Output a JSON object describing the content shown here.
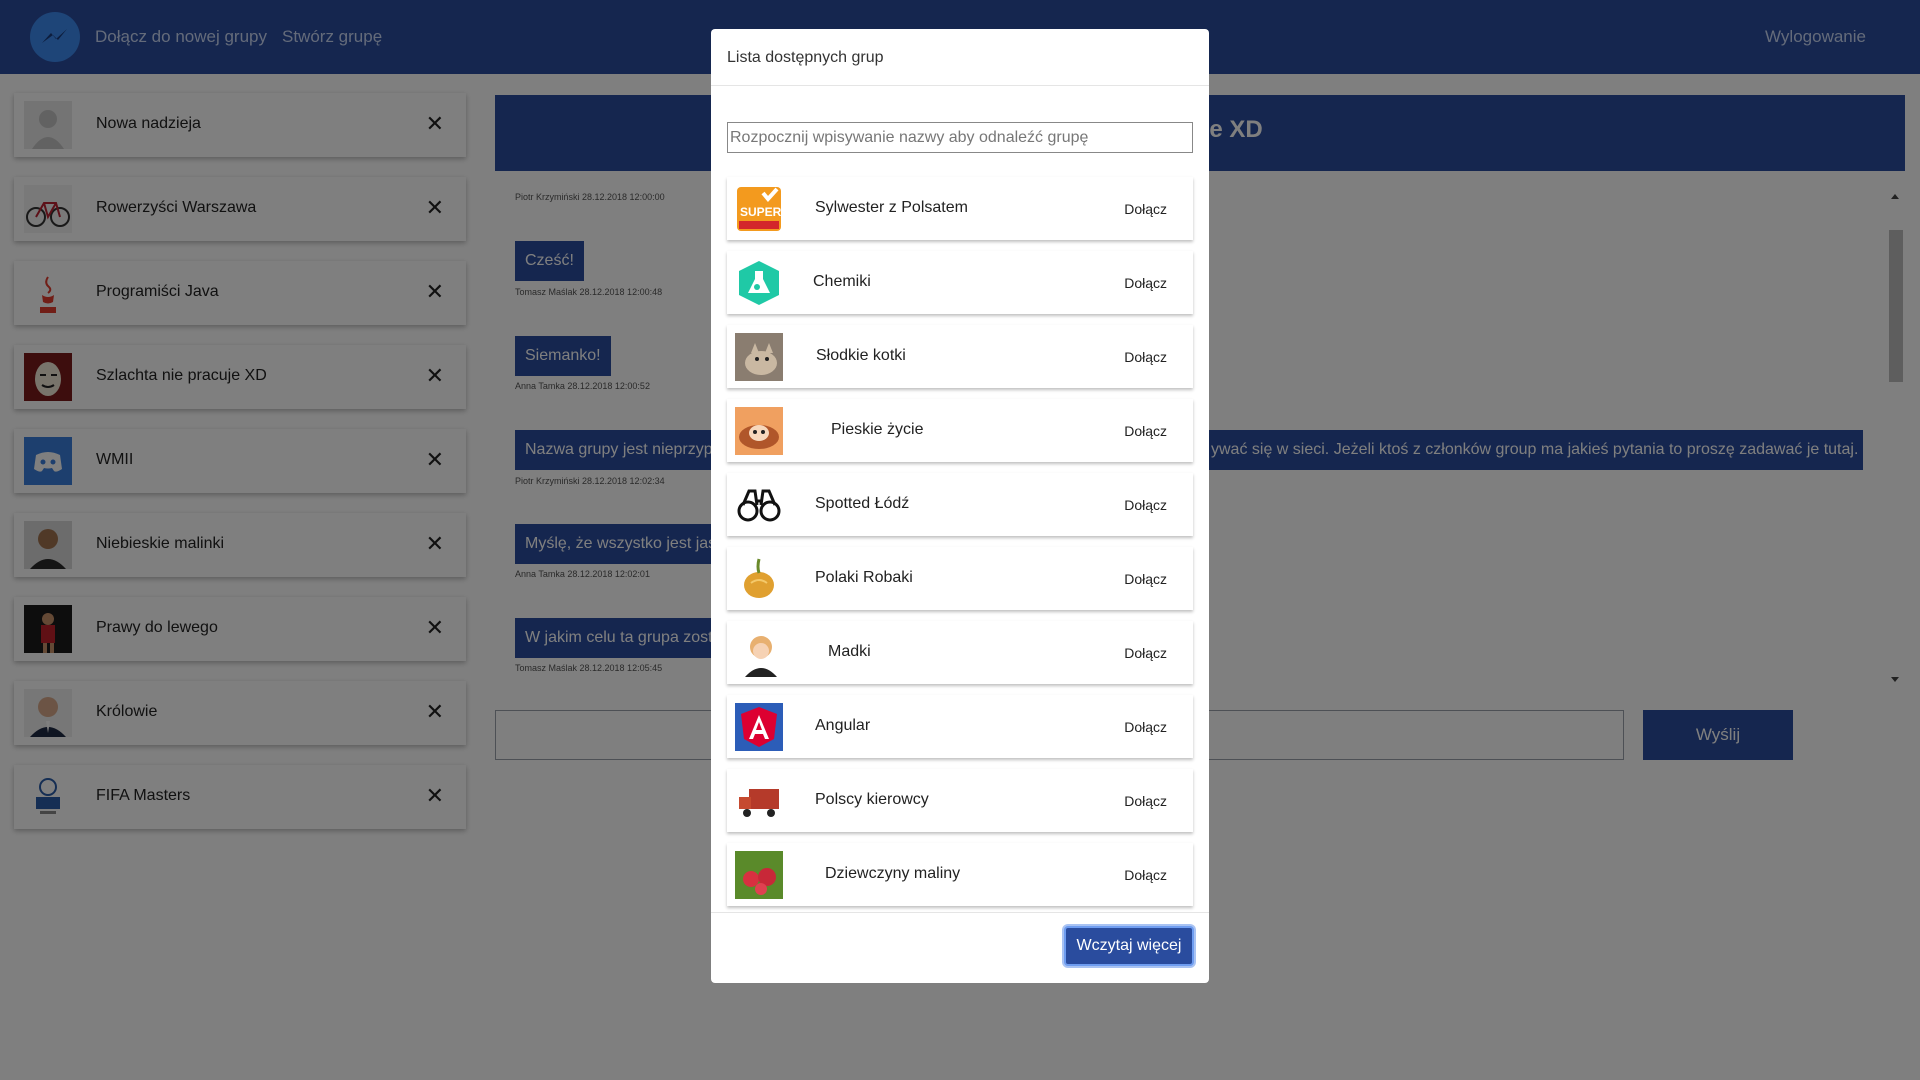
{
  "navbar": {
    "logo_icon": "messenger-logo-icon",
    "join_group": "Dołącz do nowej grupy",
    "create_group": "Stwórz grupę",
    "logout": "Wylogowanie"
  },
  "sidebar": {
    "groups": [
      {
        "name": "Nowa nadzieja",
        "icon": "default-avatar-icon"
      },
      {
        "name": "Rowerzyści Warszawa",
        "icon": "bicycle-icon"
      },
      {
        "name": "Programiści Java",
        "icon": "java-logo-icon"
      },
      {
        "name": "Szlachta nie pracuje XD",
        "icon": "mask-avatar-icon"
      },
      {
        "name": "WMII",
        "icon": "discord-icon"
      },
      {
        "name": "Niebieskie malinki",
        "icon": "man-avatar-icon"
      },
      {
        "name": "Prawy do lewego",
        "icon": "football-player-icon"
      },
      {
        "name": "Królowie",
        "icon": "man-suit-avatar-icon"
      },
      {
        "name": "FIFA Masters",
        "icon": "fifa-logo-icon"
      }
    ],
    "close_symbol": "✕"
  },
  "chat": {
    "title": "pracuje XD",
    "messages": [
      {
        "meta": "Piotr Krzymiński 28.12.2018 12:00:00",
        "text": ""
      },
      {
        "meta": "Tomasz Maślak 28.12.2018 12:00:48",
        "text": "Cześć!"
      },
      {
        "meta": "Anna Tamka 28.12.2018 12:00:52",
        "text": "Siemanko!"
      },
      {
        "meta": "Piotr Krzymiński 28.12.2018 12:02:34",
        "text": "Nazwa grupy jest nieprzyp",
        "text_right": "ywać się w sieci. Jeżeli ktoś z członków group ma jakieś pytania to proszę zadawać je tutaj."
      },
      {
        "meta": "Anna Tamka 28.12.2018 12:02:01",
        "text": "Myślę, że wszystko jest jas"
      },
      {
        "meta": "Tomasz Maślak 28.12.2018 12:05:45",
        "text": "W jakim celu ta grupa zost"
      }
    ],
    "send_label": "Wyślij"
  },
  "modal": {
    "title": "Lista dostępnych grup",
    "search_placeholder": "Rozpocznij wpisywanie nazwy aby odnaleźć grupę",
    "join_label": "Dołącz",
    "load_more": "Wczytaj więcej",
    "groups": [
      {
        "name": "Sylwester z Polsatem",
        "icon": "super-polsat-logo-icon"
      },
      {
        "name": "Chemiki",
        "icon": "chemistry-flask-icon"
      },
      {
        "name": "Słodkie kotki",
        "icon": "cat-photo-icon"
      },
      {
        "name": "Pieskie życie",
        "icon": "dog-photo-icon"
      },
      {
        "name": "Spotted Łódź",
        "icon": "binoculars-icon"
      },
      {
        "name": "Polaki Robaki",
        "icon": "onion-icon"
      },
      {
        "name": "Madki",
        "icon": "woman-photo-icon"
      },
      {
        "name": "Angular",
        "icon": "angular-logo-icon"
      },
      {
        "name": "Polscy kierowcy",
        "icon": "truck-icon"
      },
      {
        "name": "Dziewczyny maliny",
        "icon": "raspberries-icon"
      }
    ]
  }
}
